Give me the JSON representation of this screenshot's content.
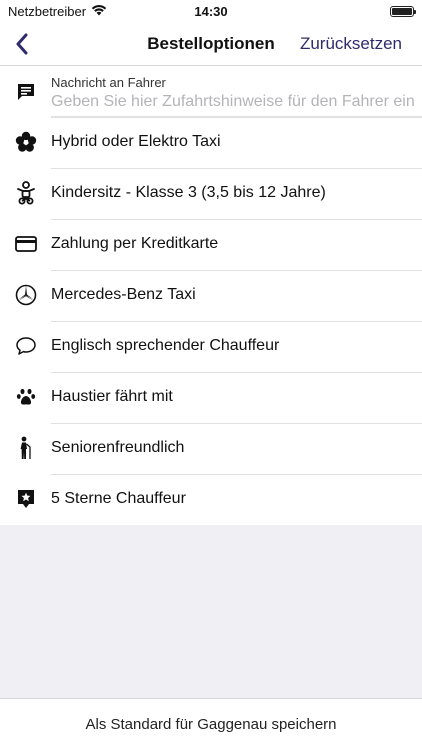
{
  "status_bar": {
    "carrier": "Netzbetreiber",
    "time": "14:30",
    "battery_level": 1.0
  },
  "nav": {
    "back_icon": "chevron-left-icon",
    "title": "Bestelloptionen",
    "reset_label": "Zurücksetzen"
  },
  "message": {
    "icon": "message-icon",
    "label": "Nachricht an Fahrer",
    "placeholder": "Geben Sie hier Zufahrtshinweise für den Fahrer ein",
    "value": ""
  },
  "options": [
    {
      "icon": "flower-icon",
      "label": "Hybrid oder Elektro Taxi"
    },
    {
      "icon": "child-seat-icon",
      "label": "Kindersitz - Klasse 3 (3,5 bis 12 Jahre)"
    },
    {
      "icon": "credit-card-icon",
      "label": "Zahlung per Kreditkarte"
    },
    {
      "icon": "mercedes-star-icon",
      "label": "Mercedes-Benz Taxi"
    },
    {
      "icon": "speech-bubble-icon",
      "label": "Englisch sprechender Chauffeur"
    },
    {
      "icon": "paw-icon",
      "label": "Haustier fährt mit"
    },
    {
      "icon": "senior-icon",
      "label": "Seniorenfreundlich"
    },
    {
      "icon": "star-badge-icon",
      "label": "5 Sterne Chauffeur"
    }
  ],
  "bottom": {
    "save_label": "Als Standard für Gaggenau speichern"
  },
  "colors": {
    "accent": "#2f2c6e",
    "background": "#efeff4"
  }
}
